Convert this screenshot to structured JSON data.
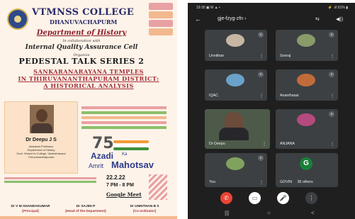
{
  "poster": {
    "college": "VTMNSS COLLEGE",
    "place": "DHANUVACHAPURM",
    "department": "Department of History",
    "collab": "In collaboration with",
    "iqac": "Internal Quality Assurance Cell",
    "organize": "Organize",
    "series": "PEDESTAL TALK SERIES 2",
    "topic_line1": "SANKARANARAYANA TEMPLES",
    "topic_line2": "IN THIRUVANANTHAPURAM DISTRICT:",
    "topic_line3": "A HISTORICAL ANALYSIS",
    "speaker_name": "Dr Deepu J S",
    "speaker_role": "Assistant Professor",
    "speaker_dept": "Department of History",
    "speaker_college": "Govt. Women's College, Vazhuthacaud",
    "speaker_city": "Thiruvananthapuram",
    "azadi_75": "75",
    "azadi": "Azadi",
    "ka": "Ka",
    "amrit": "Amrit",
    "mahotsav": "Mahotsav",
    "date": "22.2.22",
    "time": "7 PM - 8 PM",
    "platform": "Google Meet",
    "coordinators": [
      {
        "name": "Dr V M ANANDAKUMAR",
        "role": "[Principal]"
      },
      {
        "name": "Dr SAJINI P",
        "role": "[Head of the Department]"
      },
      {
        "name": "Dr UNNITHAN B S",
        "role": "[Co-ordinator]"
      }
    ],
    "colors": {
      "maroon": "#8a1e2a",
      "navy": "#2a2a6a",
      "peach": "#fbe2c8",
      "pink": "#e9a1a3",
      "green": "#8cbf6a",
      "orange": "#f2b98e"
    }
  },
  "phone": {
    "status_time": "19:30 ▣ M ▲ •",
    "status_right": "⚡ .ıll 61% ▮",
    "back_icon": "←",
    "meeting_code": "gje-fzyg-zfn ›",
    "cam_switch_icon": "⇆",
    "speaker_icon": "◀))",
    "participants": [
      {
        "name": "Unnithan",
        "avatar_color": "#c7b7a2"
      },
      {
        "name": "Sooraj",
        "avatar_color": "#8a9b6a"
      },
      {
        "name": "IQAC",
        "avatar_color": "#6aa2c9"
      },
      {
        "name": "Ananthasai",
        "avatar_color": "#c26b3a"
      },
      {
        "name": "Dr Deepu",
        "avatar_color": "#6b4b3a"
      },
      {
        "name": "ANJANA",
        "avatar_color": "#b54a7e"
      },
      {
        "name": "You",
        "avatar_color": "#7fa35e"
      },
      {
        "name": "GOVIN",
        "extra": "35 others",
        "avatar_letter": "G"
      }
    ],
    "controls": {
      "end": "✆",
      "camera": "▭",
      "mic": "🎤",
      "more": "⋮"
    },
    "nav": {
      "recent": "|||",
      "home": "○",
      "back": "<"
    }
  }
}
